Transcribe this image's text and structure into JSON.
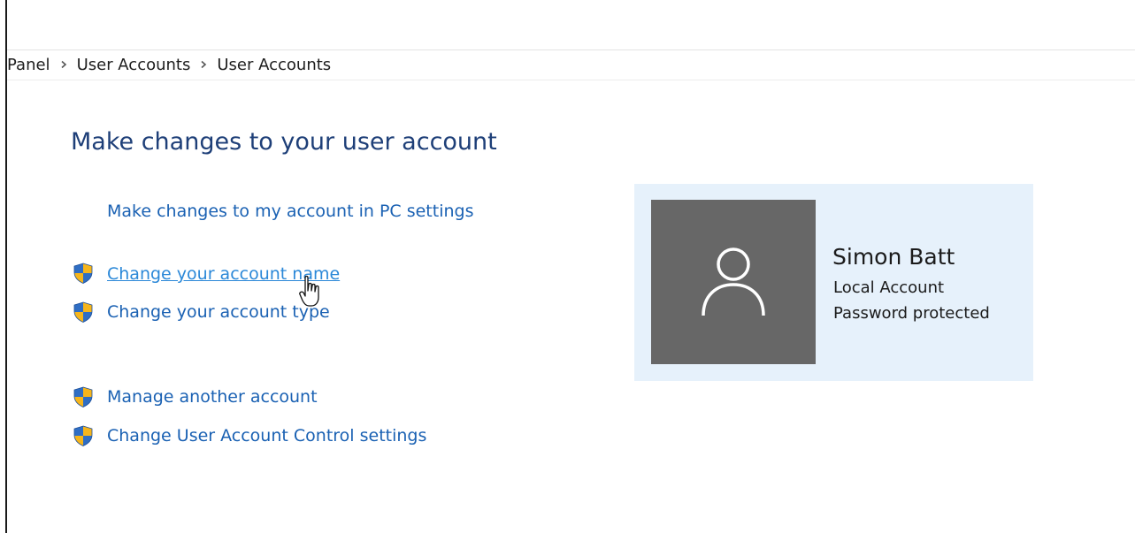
{
  "breadcrumb": {
    "items": [
      "Panel",
      "User Accounts",
      "User Accounts"
    ]
  },
  "main": {
    "title": "Make changes to your user account",
    "pc_settings_link": "Make changes to my account in PC settings",
    "links": [
      {
        "label": "Change your account name",
        "icon": "uac-shield-icon",
        "state": "hover"
      },
      {
        "label": "Change your account type",
        "icon": "uac-shield-icon"
      },
      {
        "label": "Manage another account",
        "icon": "uac-shield-icon"
      },
      {
        "label": "Change User Account Control settings",
        "icon": "uac-shield-icon"
      }
    ]
  },
  "account": {
    "name": "Simon Batt",
    "type": "Local Account",
    "status": "Password protected",
    "avatar_icon": "user-silhouette-icon"
  },
  "colors": {
    "title": "#1e3f78",
    "link": "#1a61b3",
    "link_hover": "#2b88d8",
    "card_bg": "#e6f1fb",
    "avatar_bg": "#676767",
    "shield_blue": "#2f6ec4",
    "shield_yellow": "#f6b51b"
  }
}
